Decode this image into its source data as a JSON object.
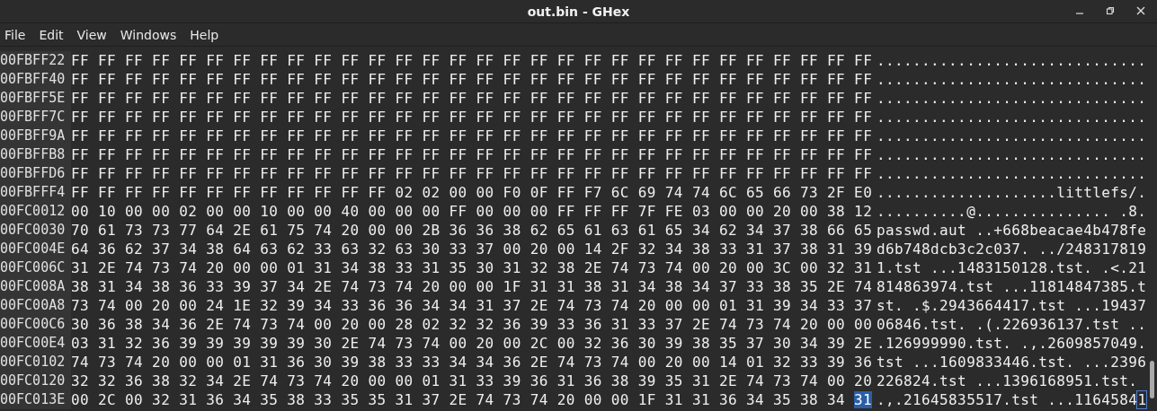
{
  "window": {
    "title": "out.bin - GHex"
  },
  "menu": [
    "File",
    "Edit",
    "View",
    "Windows",
    "Help"
  ],
  "rows": [
    {
      "offset": "00FBFF22",
      "hex": [
        {
          "text": "FF FF FF FF FF FF FF FF FF FF FF FF FF FF FF FF FF FF FF FF FF FF FF FF FF FF FF FF FF FF",
          "selected": false
        }
      ],
      "ascii": [
        {
          "text": "..............................",
          "selected": false
        }
      ]
    },
    {
      "offset": "00FBFF40",
      "hex": [
        {
          "text": "FF FF FF FF FF FF FF FF FF FF FF FF FF FF FF FF FF FF FF FF FF FF FF FF FF FF FF FF FF FF",
          "selected": false
        }
      ],
      "ascii": [
        {
          "text": "..............................",
          "selected": false
        }
      ]
    },
    {
      "offset": "00FBFF5E",
      "hex": [
        {
          "text": "FF FF FF FF FF FF FF FF FF FF FF FF FF FF FF FF FF FF FF FF FF FF FF FF FF FF FF FF FF FF",
          "selected": false
        }
      ],
      "ascii": [
        {
          "text": "..............................",
          "selected": false
        }
      ]
    },
    {
      "offset": "00FBFF7C",
      "hex": [
        {
          "text": "FF FF FF FF FF FF FF FF FF FF FF FF FF FF FF FF FF FF FF FF FF FF FF FF FF FF FF FF FF FF",
          "selected": false
        }
      ],
      "ascii": [
        {
          "text": "..............................",
          "selected": false
        }
      ]
    },
    {
      "offset": "00FBFF9A",
      "hex": [
        {
          "text": "FF FF FF FF FF FF FF FF FF FF FF FF FF FF FF FF FF FF FF FF FF FF FF FF FF FF FF FF FF FF",
          "selected": false
        }
      ],
      "ascii": [
        {
          "text": "..............................",
          "selected": false
        }
      ]
    },
    {
      "offset": "00FBFFB8",
      "hex": [
        {
          "text": "FF FF FF FF FF FF FF FF FF FF FF FF FF FF FF FF FF FF FF FF FF FF FF FF FF FF FF FF FF FF",
          "selected": false
        }
      ],
      "ascii": [
        {
          "text": "..............................",
          "selected": false
        }
      ]
    },
    {
      "offset": "00FBFFD6",
      "hex": [
        {
          "text": "FF FF FF FF FF FF FF FF FF FF FF FF FF FF FF FF FF FF FF FF FF FF FF FF FF FF FF FF FF FF",
          "selected": false
        }
      ],
      "ascii": [
        {
          "text": "..............................",
          "selected": false
        }
      ]
    },
    {
      "offset": "00FBFFF4",
      "hex": [
        {
          "text": "FF FF FF FF FF FF FF FF FF FF FF FF 02 02 00 00 F0 0F FF F7 6C 69 74 74 6C 65 66 73 2F E0",
          "selected": false
        }
      ],
      "ascii": [
        {
          "text": "....................littlefs/.",
          "selected": false
        }
      ]
    },
    {
      "offset": "00FC0012",
      "hex": [
        {
          "text": "00 10 00 00 02 00 00 10 00 00 40 00 00 00 FF 00 00 00 FF FF FF 7F FE 03 00 00 20 00 38 12",
          "selected": false
        }
      ],
      "ascii": [
        {
          "text": "..........@............... .8.",
          "selected": false
        }
      ]
    },
    {
      "offset": "00FC0030",
      "hex": [
        {
          "text": "70 61 73 73 77 64 2E 61 75 74 20 00 00 2B 36 36 38 62 65 61 63 61 65 34 62 34 37 38 66 65",
          "selected": false
        }
      ],
      "ascii": [
        {
          "text": "passwd.aut ..+668beacae4b478fe",
          "selected": false
        }
      ]
    },
    {
      "offset": "00FC004E",
      "hex": [
        {
          "text": "64 36 62 37 34 38 64 63 62 33 63 32 63 30 33 37 00 20 00 14 2F 32 34 38 33 31 37 38 31 39",
          "selected": false
        }
      ],
      "ascii": [
        {
          "text": "d6b748dcb3c2c037. ../248317819",
          "selected": false
        }
      ]
    },
    {
      "offset": "00FC006C",
      "hex": [
        {
          "text": "31 2E 74 73 74 20 00 00 01 31 34 38 33 31 35 30 31 32 38 2E 74 73 74 00 20 00 3C 00 32 31",
          "selected": false
        }
      ],
      "ascii": [
        {
          "text": "1.tst ...1483150128.tst. .<.21",
          "selected": false
        }
      ]
    },
    {
      "offset": "00FC008A",
      "hex": [
        {
          "text": "38 31 34 38 36 33 39 37 34 2E 74 73 74 20 00 00 1F 31 31 38 31 34 38 34 37 33 38 35 2E 74",
          "selected": false
        }
      ],
      "ascii": [
        {
          "text": "814863974.tst ...11814847385.t",
          "selected": false
        }
      ]
    },
    {
      "offset": "00FC00A8",
      "hex": [
        {
          "text": "73 74 00 20 00 24 1E 32 39 34 33 36 36 34 34 31 37 2E 74 73 74 20 00 00 01 31 39 34 33 37",
          "selected": false
        }
      ],
      "ascii": [
        {
          "text": "st. .$.2943664417.tst ...19437",
          "selected": false
        }
      ]
    },
    {
      "offset": "00FC00C6",
      "hex": [
        {
          "text": "30 36 38 34 36 2E 74 73 74 00 20 00 28 02 32 32 36 39 33 36 31 33 37 2E 74 73 74 20 00 00",
          "selected": false
        }
      ],
      "ascii": [
        {
          "text": "06846.tst. .(.226936137.tst ..",
          "selected": false
        }
      ]
    },
    {
      "offset": "00FC00E4",
      "hex": [
        {
          "text": "03 31 32 36 39 39 39 39 39 30 2E 74 73 74 00 20 00 2C 00 32 36 30 39 38 35 37 30 34 39 2E",
          "selected": false
        }
      ],
      "ascii": [
        {
          "text": ".126999990.tst. .,.2609857049.",
          "selected": false
        }
      ]
    },
    {
      "offset": "00FC0102",
      "hex": [
        {
          "text": "74 73 74 20 00 00 01 31 36 30 39 38 33 33 34 34 36 2E 74 73 74 00 20 00 14 01 32 33 39 36",
          "selected": false
        }
      ],
      "ascii": [
        {
          "text": "tst ...1609833446.tst. ...2396",
          "selected": false
        }
      ]
    },
    {
      "offset": "00FC0120",
      "hex": [
        {
          "text": "32 32 36 38 32 34 2E 74 73 74 20 00 00 01 31 33 39 36 31 36 38 39 35 31 2E 74 73 74 00 20",
          "selected": false
        }
      ],
      "ascii": [
        {
          "text": "226824.tst ...1396168951.tst.",
          "selected": false
        }
      ]
    },
    {
      "offset": "00FC013E",
      "hex": [
        {
          "text": "00 2C 00 32 31 36 34 35 38 33 35 35 31 37 2E 74 73 74 20 00 00 1F 31 31 36 34 35 38 34",
          "selected": false
        },
        {
          "text": "31",
          "selected": true
        }
      ],
      "ascii": [
        {
          "text": ".,.21645835517.tst ...1164584",
          "selected": false
        },
        {
          "text": "1",
          "selected": true
        }
      ]
    }
  ]
}
